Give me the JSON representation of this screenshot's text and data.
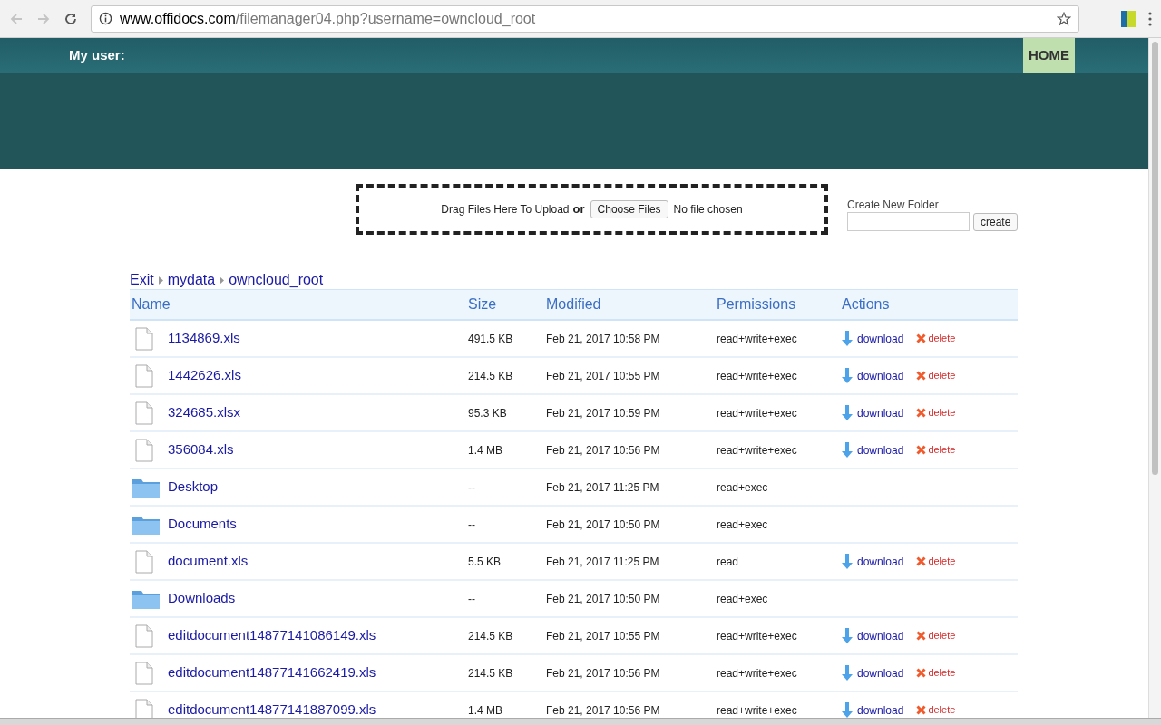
{
  "browser": {
    "url_host": "www.offidocs.com",
    "url_path": "/filemanager04.php?username=owncloud_root"
  },
  "header": {
    "user_label": "My user:",
    "home_button": "HOME"
  },
  "upload": {
    "drag_text": "Drag Files Here To Upload",
    "or_text": "or",
    "choose_button": "Choose Files",
    "file_status": "No file chosen"
  },
  "new_folder": {
    "label": "Create New Folder",
    "button": "create"
  },
  "breadcrumb": [
    "Exit",
    "mydata",
    "owncloud_root"
  ],
  "table": {
    "columns": [
      "Name",
      "Size",
      "Modified",
      "Permissions",
      "Actions"
    ],
    "rows": [
      {
        "kind": "file",
        "name": "1134869.xls",
        "size": "491.5 KB",
        "modified": "Feb 21, 2017 10:58 PM",
        "permissions": "read+write+exec",
        "actions": [
          "download",
          "delete"
        ]
      },
      {
        "kind": "file",
        "name": "1442626.xls",
        "size": "214.5 KB",
        "modified": "Feb 21, 2017 10:55 PM",
        "permissions": "read+write+exec",
        "actions": [
          "download",
          "delete"
        ]
      },
      {
        "kind": "file",
        "name": "324685.xlsx",
        "size": "95.3 KB",
        "modified": "Feb 21, 2017 10:59 PM",
        "permissions": "read+write+exec",
        "actions": [
          "download",
          "delete"
        ]
      },
      {
        "kind": "file",
        "name": "356084.xls",
        "size": "1.4 MB",
        "modified": "Feb 21, 2017 10:56 PM",
        "permissions": "read+write+exec",
        "actions": [
          "download",
          "delete"
        ]
      },
      {
        "kind": "folder",
        "name": "Desktop",
        "size": "--",
        "modified": "Feb 21, 2017 11:25 PM",
        "permissions": "read+exec"
      },
      {
        "kind": "folder",
        "name": "Documents",
        "size": "--",
        "modified": "Feb 21, 2017 10:50 PM",
        "permissions": "read+exec"
      },
      {
        "kind": "file",
        "name": "document.xls",
        "size": "5.5 KB",
        "modified": "Feb 21, 2017 11:25 PM",
        "permissions": "read",
        "actions": [
          "download",
          "delete"
        ]
      },
      {
        "kind": "folder",
        "name": "Downloads",
        "size": "--",
        "modified": "Feb 21, 2017 10:50 PM",
        "permissions": "read+exec"
      },
      {
        "kind": "file",
        "name": "editdocument14877141086149.xls",
        "size": "214.5 KB",
        "modified": "Feb 21, 2017 10:55 PM",
        "permissions": "read+write+exec",
        "actions": [
          "download",
          "delete"
        ]
      },
      {
        "kind": "file",
        "name": "editdocument14877141662419.xls",
        "size": "214.5 KB",
        "modified": "Feb 21, 2017 10:56 PM",
        "permissions": "read+write+exec",
        "actions": [
          "download",
          "delete"
        ]
      },
      {
        "kind": "file",
        "name": "editdocument14877141887099.xls",
        "size": "1.4 MB",
        "modified": "Feb 21, 2017 10:56 PM",
        "permissions": "read+write+exec",
        "actions": [
          "download",
          "delete"
        ]
      }
    ]
  }
}
